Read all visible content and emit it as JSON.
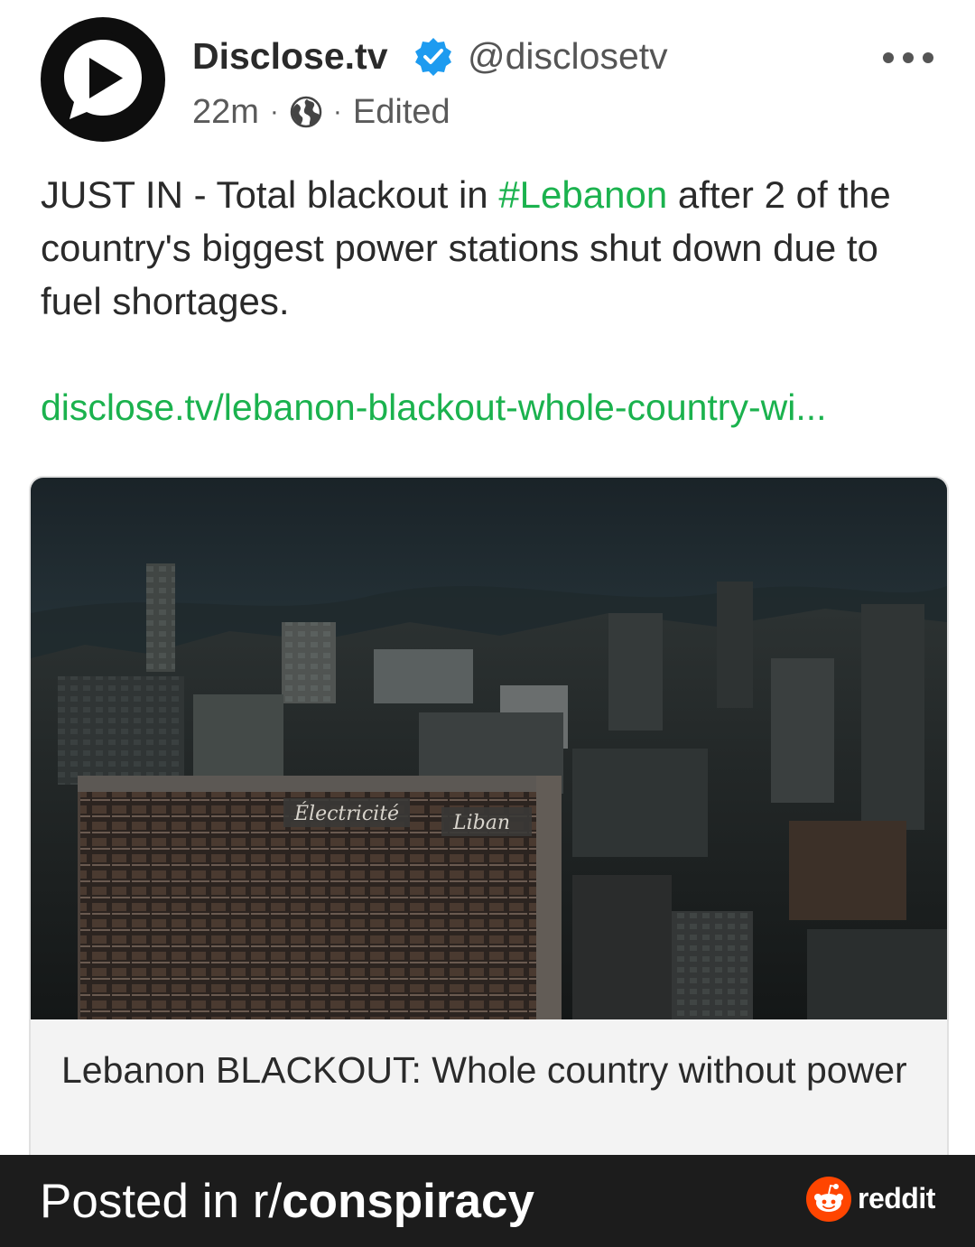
{
  "post": {
    "author": "Disclose.tv",
    "handle": "@disclosetv",
    "verified": true,
    "time": "22m",
    "edited_label": "Edited",
    "text_before_hashtag": "JUST IN - Total blackout in ",
    "hashtag": "#Lebanon",
    "text_after_hashtag": " after 2 of the country's biggest power stations shut down due to fuel shortages.",
    "link": "disclose.tv/lebanon-blackout-whole-country-wi...",
    "colors": {
      "accent": "#1bb24e",
      "verified": "#1d9bf0"
    }
  },
  "card": {
    "sign_text_left": "Électricité",
    "sign_text_right": "Liban",
    "title": "Lebanon BLACKOUT: Whole country without power"
  },
  "footer": {
    "prefix": "Posted in r/",
    "subreddit": "conspiracy",
    "brand": "reddit",
    "brand_color": "#ff4500"
  },
  "icons": {
    "avatar": "play-bubble-icon",
    "verified": "verified-check-icon",
    "visibility": "globe-icon",
    "menu": "more-options-icon",
    "brand": "reddit-alien-icon"
  }
}
